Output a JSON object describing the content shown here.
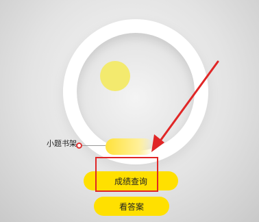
{
  "shelf": {
    "label": "小题书架"
  },
  "buttons": {
    "query_label": "成绩查询",
    "answers_label": "看答案"
  },
  "colors": {
    "accent_yellow": "#ffe000",
    "annotation_red": "#e02626",
    "dot_yellow": "#f3ea6e"
  }
}
